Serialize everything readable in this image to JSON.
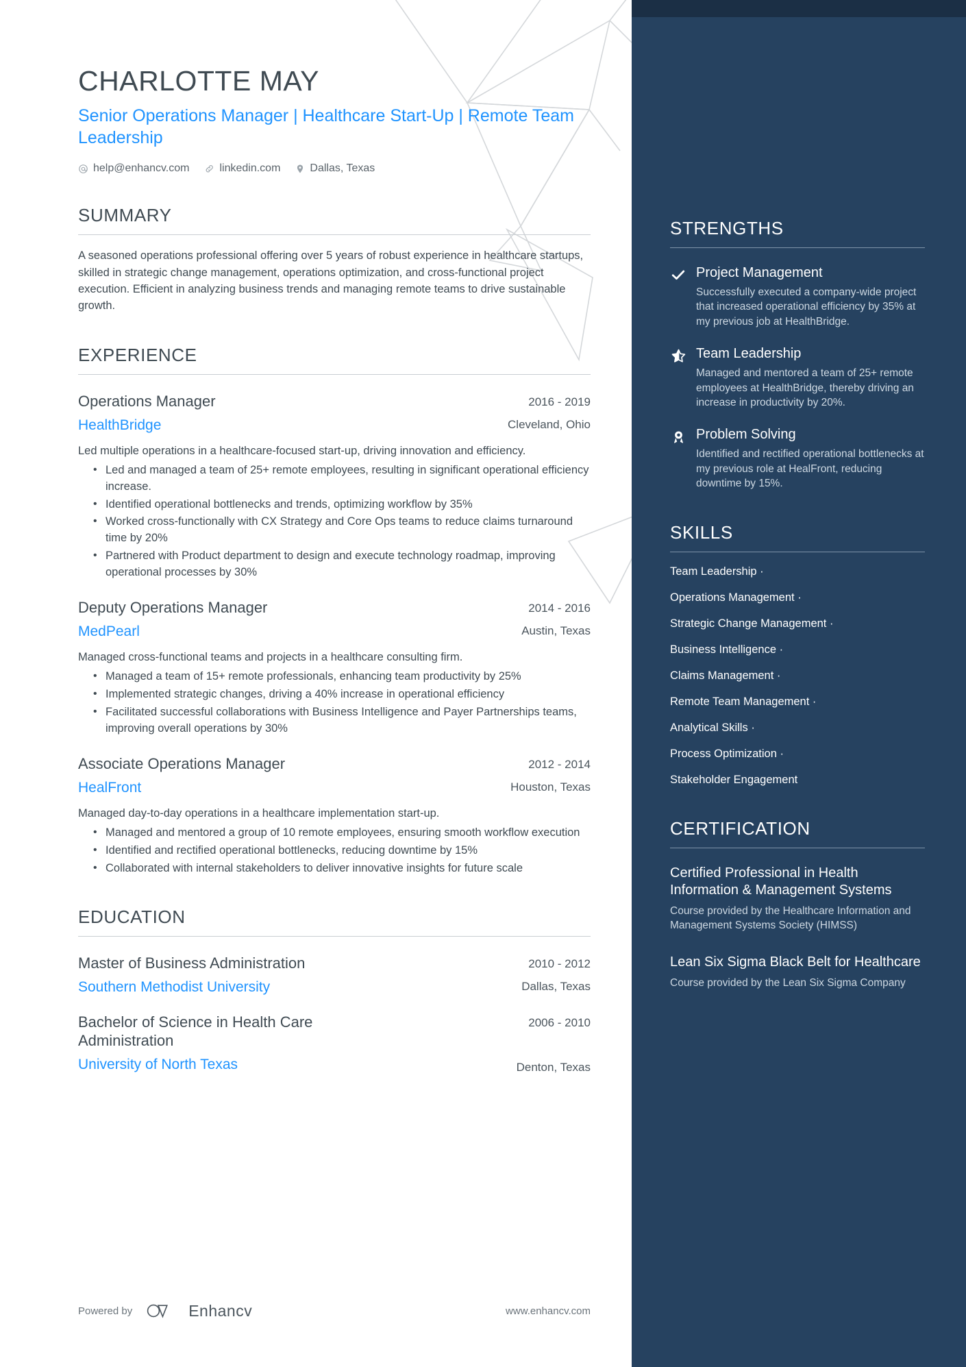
{
  "header": {
    "name": "CHARLOTTE MAY",
    "headline": "Senior Operations Manager | Healthcare Start-Up | Remote Team Leadership",
    "contacts": [
      {
        "icon": "at-sign-icon",
        "text": "help@enhancv.com"
      },
      {
        "icon": "link-icon",
        "text": "linkedin.com"
      },
      {
        "icon": "location-pin-icon",
        "text": "Dallas, Texas"
      }
    ]
  },
  "summary": {
    "title": "SUMMARY",
    "text": "A seasoned operations professional offering over 5 years of robust experience in healthcare startups, skilled in strategic change management, operations optimization, and cross-functional project execution. Efficient in analyzing business trends and managing remote teams to drive sustainable growth."
  },
  "experience": {
    "title": "EXPERIENCE",
    "entries": [
      {
        "role": "Operations Manager",
        "org": "HealthBridge",
        "dates": "2016 - 2019",
        "place": "Cleveland, Ohio",
        "desc": "Led multiple operations in a healthcare-focused start-up, driving innovation and efficiency.",
        "bullets": [
          "Led and managed a team of 25+ remote employees, resulting in significant operational efficiency increase.",
          "Identified operational bottlenecks and trends, optimizing workflow by 35%",
          "Worked cross-functionally with CX Strategy and Core Ops teams to reduce claims turnaround time by 20%",
          "Partnered with Product department to design and execute technology roadmap, improving operational processes by 30%"
        ]
      },
      {
        "role": "Deputy Operations Manager",
        "org": "MedPearl",
        "dates": "2014 - 2016",
        "place": "Austin, Texas",
        "desc": "Managed cross-functional teams and projects in a healthcare consulting firm.",
        "bullets": [
          "Managed a team of 15+ remote professionals, enhancing team productivity by 25%",
          "Implemented strategic changes, driving a 40% increase in operational efficiency",
          "Facilitated successful collaborations with Business Intelligence and Payer Partnerships teams, improving overall operations by 30%"
        ]
      },
      {
        "role": "Associate Operations Manager",
        "org": "HealFront",
        "dates": "2012 - 2014",
        "place": "Houston, Texas",
        "desc": "Managed day-to-day operations in a healthcare implementation start-up.",
        "bullets": [
          "Managed and mentored a group of 10 remote employees, ensuring smooth workflow execution",
          "Identified and rectified operational bottlenecks, reducing downtime by 15%",
          "Collaborated with internal stakeholders to deliver innovative insights for future scale"
        ]
      }
    ]
  },
  "education": {
    "title": "EDUCATION",
    "entries": [
      {
        "degree": "Master of Business Administration",
        "school": "Southern Methodist University",
        "dates": "2010 - 2012",
        "place": "Dallas, Texas"
      },
      {
        "degree": "Bachelor of Science in Health Care Administration",
        "school": "University of North Texas",
        "dates": "2006 - 2010",
        "place": "Denton, Texas"
      }
    ]
  },
  "strengths": {
    "title": "STRENGTHS",
    "items": [
      {
        "icon": "check-icon",
        "name": "Project Management",
        "desc": "Successfully executed a company-wide project that increased operational efficiency by 35% at my previous job at HealthBridge."
      },
      {
        "icon": "star-icon",
        "name": "Team Leadership",
        "desc": "Managed and mentored a team of 25+ remote employees at HealthBridge, thereby driving an increase in productivity by 20%."
      },
      {
        "icon": "award-medal-icon",
        "name": "Problem Solving",
        "desc": "Identified and rectified operational bottlenecks at my previous role at HealFront, reducing downtime by 15%."
      }
    ]
  },
  "skills": {
    "title": "SKILLS",
    "separator": "·",
    "items": [
      "Team Leadership",
      "Operations Management",
      "Strategic Change Management",
      "Business Intelligence",
      "Claims Management",
      "Remote Team Management",
      "Analytical Skills",
      "Process Optimization",
      "Stakeholder Engagement"
    ]
  },
  "certification": {
    "title": "CERTIFICATION",
    "items": [
      {
        "name": "Certified Professional in Health Information & Management Systems",
        "desc": "Course provided by the Healthcare Information and Management Systems Society (HIMSS)"
      },
      {
        "name": "Lean Six Sigma Black Belt for Healthcare",
        "desc": "Course provided by the Lean Six Sigma Company"
      }
    ]
  },
  "footer": {
    "powered_by": "Powered by",
    "brand": "Enhancv",
    "website": "www.enhancv.com"
  },
  "colors": {
    "accent_blue": "#1f93ff",
    "sidebar_bg": "#264260",
    "sidebar_topband": "#1b2f45",
    "text_dark": "#3f4a52"
  }
}
